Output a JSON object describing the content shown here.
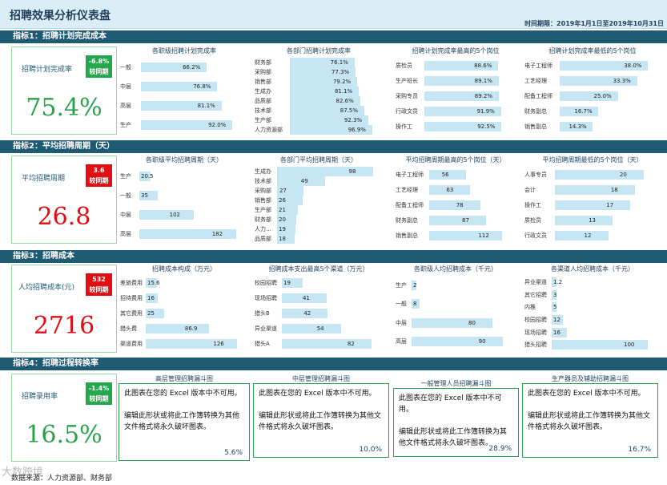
{
  "header": {
    "title": "招聘效果分析仪表盘",
    "period": "时间期限：2019年1月1日至2019年10月31日"
  },
  "sections": [
    {
      "label": "指标1：招聘计划完成成本"
    },
    {
      "label": "指标2：平均招聘周期（天）"
    },
    {
      "label": "指标3：招聘成本"
    },
    {
      "label": "指标4：招聘过程转换率"
    }
  ],
  "kpis": [
    {
      "label": "招聘计划完成率",
      "value": "75.4%",
      "badge_value": "-6.8%",
      "badge_text": "较同期",
      "color": "#2aa24b"
    },
    {
      "label": "平均招聘周期",
      "value": "26.8",
      "badge_value": "3.6",
      "badge_text": "较同期",
      "color": "#e20e14"
    },
    {
      "label": "人均招聘成本(元)",
      "value": "2716",
      "badge_value": "532",
      "badge_text": "较同期",
      "color": "#e20e14"
    },
    {
      "label": "招聘录用率",
      "value": "16.5%",
      "badge_value": "-1.4%",
      "badge_text": "较同期",
      "color": "#2aa24b"
    }
  ],
  "panels": [
    {
      "title": "各职级招聘计划完成率",
      "max": 100,
      "items": [
        {
          "label": "一般",
          "value": 66.2,
          "text": "66.2%"
        },
        {
          "label": "中层",
          "value": 76.8,
          "text": "76.8%"
        },
        {
          "label": "高层",
          "value": 81.1,
          "text": "81.1%"
        },
        {
          "label": "生产",
          "value": 92.0,
          "text": "92.0%"
        }
      ]
    },
    {
      "title": "各部门招聘计划完成率",
      "max": 100,
      "items": [
        {
          "label": "财务部",
          "value": 76.1,
          "text": "76.1%"
        },
        {
          "label": "采购部",
          "value": 77.3,
          "text": "77.3%"
        },
        {
          "label": "销售部",
          "value": 79.2,
          "text": "79.2%"
        },
        {
          "label": "生成办",
          "value": 81.1,
          "text": "81.1%"
        },
        {
          "label": "品质部",
          "value": 82.6,
          "text": "82.6%"
        },
        {
          "label": "技术部",
          "value": 87.5,
          "text": "87.5%"
        },
        {
          "label": "生产部",
          "value": 92.3,
          "text": "92.3%"
        },
        {
          "label": "人力资源部",
          "value": 96.9,
          "text": "96.9%"
        }
      ]
    },
    {
      "title": "招聘计划完成率最高的5个岗位",
      "max": 100,
      "items": [
        {
          "label": "质检员",
          "value": 88.6,
          "text": "88.6%"
        },
        {
          "label": "生产班长",
          "value": 89.1,
          "text": "89.1%"
        },
        {
          "label": "采购专员",
          "value": 89.2,
          "text": "89.2%"
        },
        {
          "label": "行政文员",
          "value": 91.9,
          "text": "91.9%"
        },
        {
          "label": "操作工",
          "value": 92.5,
          "text": "92.5%"
        }
      ]
    },
    {
      "title": "招聘计划完成率最低的5个岗位",
      "max": 40,
      "items": [
        {
          "label": "电子工程师",
          "value": 38.0,
          "text": "38.0%"
        },
        {
          "label": "工艺经理",
          "value": 33.3,
          "text": "33.3%"
        },
        {
          "label": "配备工程师",
          "value": 25.0,
          "text": "25.0%"
        },
        {
          "label": "财务副总",
          "value": 16.7,
          "text": "16.7%"
        },
        {
          "label": "销售副总",
          "value": 14.3,
          "text": "14.3%"
        }
      ]
    },
    {
      "title": "各职级平均招聘周期（天）",
      "max": 190,
      "items": [
        {
          "label": "生产",
          "value": 20.5,
          "text": "20.5"
        },
        {
          "label": "一般",
          "value": 35,
          "text": "35"
        },
        {
          "label": "中层",
          "value": 102,
          "text": "102"
        },
        {
          "label": "高层",
          "value": 182,
          "text": "182"
        }
      ]
    },
    {
      "title": "各部门平均招聘周期（天）",
      "max": 100,
      "items": [
        {
          "label": "生成办",
          "value": 98,
          "text": "98"
        },
        {
          "label": "技术部",
          "value": 49,
          "text": "49"
        },
        {
          "label": "采购部",
          "value": 27,
          "text": "27"
        },
        {
          "label": "销售部",
          "value": 26,
          "text": "26"
        },
        {
          "label": "生产部",
          "value": 21,
          "text": "21"
        },
        {
          "label": "财务部",
          "value": 20,
          "text": "20"
        },
        {
          "label": "人力...",
          "value": 19,
          "text": "19"
        },
        {
          "label": "品质部",
          "value": 18,
          "text": "18"
        }
      ]
    },
    {
      "title": "平均招聘周期最高的5个岗位（天）",
      "max": 120,
      "items": [
        {
          "label": "电子工程师",
          "value": 56,
          "text": "56"
        },
        {
          "label": "工艺经理",
          "value": 63,
          "text": "63"
        },
        {
          "label": "配备工程师",
          "value": 78,
          "text": "78"
        },
        {
          "label": "财务副总",
          "value": 87,
          "text": "87"
        },
        {
          "label": "销售副总",
          "value": 112,
          "text": "112"
        }
      ]
    },
    {
      "title": "平均招聘周期最低的5个岗位（天）",
      "max": 22,
      "items": [
        {
          "label": "人事专员",
          "value": 20,
          "text": "20"
        },
        {
          "label": "会计",
          "value": 18,
          "text": "18"
        },
        {
          "label": "操作工",
          "value": 17,
          "text": "17"
        },
        {
          "label": "质检员",
          "value": 13,
          "text": "13"
        },
        {
          "label": "行政文员",
          "value": 12,
          "text": "12"
        }
      ]
    },
    {
      "title": "招聘成本构成（万元）",
      "max": 130,
      "items": [
        {
          "label": "差旅费用",
          "value": 15.6,
          "text": "15.6"
        },
        {
          "label": "招待费用",
          "value": 16,
          "text": "16"
        },
        {
          "label": "其它费用",
          "value": 25,
          "text": "25"
        },
        {
          "label": "猎头费",
          "value": 86.9,
          "text": "86.9"
        },
        {
          "label": "渠道费用",
          "value": 126,
          "text": "126"
        }
      ]
    },
    {
      "title": "招聘成本支出最高5个渠道（万元）",
      "max": 85,
      "items": [
        {
          "label": "校园招聘",
          "value": 19,
          "text": "19"
        },
        {
          "label": "现场招聘",
          "value": 41,
          "text": "41"
        },
        {
          "label": "猎头B",
          "value": 42,
          "text": "42"
        },
        {
          "label": "异业渠道",
          "value": 54,
          "text": "54"
        },
        {
          "label": "猎头A",
          "value": 82,
          "text": "82"
        }
      ]
    },
    {
      "title": "各职级人均招聘成本（千元）",
      "max": 95,
      "items": [
        {
          "label": "生产",
          "value": 2,
          "text": "2"
        },
        {
          "label": "一般",
          "value": 8,
          "text": "8"
        },
        {
          "label": "中层",
          "value": 80,
          "text": "80"
        },
        {
          "label": "高层",
          "value": 90,
          "text": "90"
        }
      ]
    },
    {
      "title": "各渠道人均招聘成本（千元）",
      "max": 105,
      "items": [
        {
          "label": "异业渠道",
          "value": 1.2,
          "text": "1.2"
        },
        {
          "label": "其它招聘",
          "value": 3,
          "text": "3"
        },
        {
          "label": "内推",
          "value": 5,
          "text": "5"
        },
        {
          "label": "校园招聘",
          "value": 12,
          "text": "12"
        },
        {
          "label": "现场招聘",
          "value": 16,
          "text": "16"
        },
        {
          "label": "猎头招聘",
          "value": 100,
          "text": "100"
        }
      ]
    }
  ],
  "funnels": [
    {
      "title": "高层管理招聘漏斗图",
      "text": "此图表在您的 Excel 版本中不可用。\n\n编辑此形状或将此工作簿转换为其他文件格式将永久破坏图表。",
      "pct": "5.6%"
    },
    {
      "title": "中层管理招聘漏斗图",
      "text": "此图表在您的 Excel 版本中不可用。\n\n编辑此形状或将此工作簿转换为其他文件格式将永久破坏图表。",
      "pct": "10.0%"
    },
    {
      "title": "一般管理人员招聘漏斗图",
      "text": "此图表在您的 Excel 版本中不可用。\n\n编辑此形状或将此工作簿转换为其他文件格式将永久破坏图表。",
      "pct": "28.9%"
    },
    {
      "title": "生产器员及辅助招聘漏斗图",
      "text": "此图表在您的 Excel 版本中不可用。\n\n编辑此形状或将此工作簿转换为其他文件格式将永久破坏图表。",
      "pct": "16.7%"
    }
  ],
  "footer": {
    "source": "数据来源：人力资源部、财务部",
    "watermark": "大数跨境"
  }
}
